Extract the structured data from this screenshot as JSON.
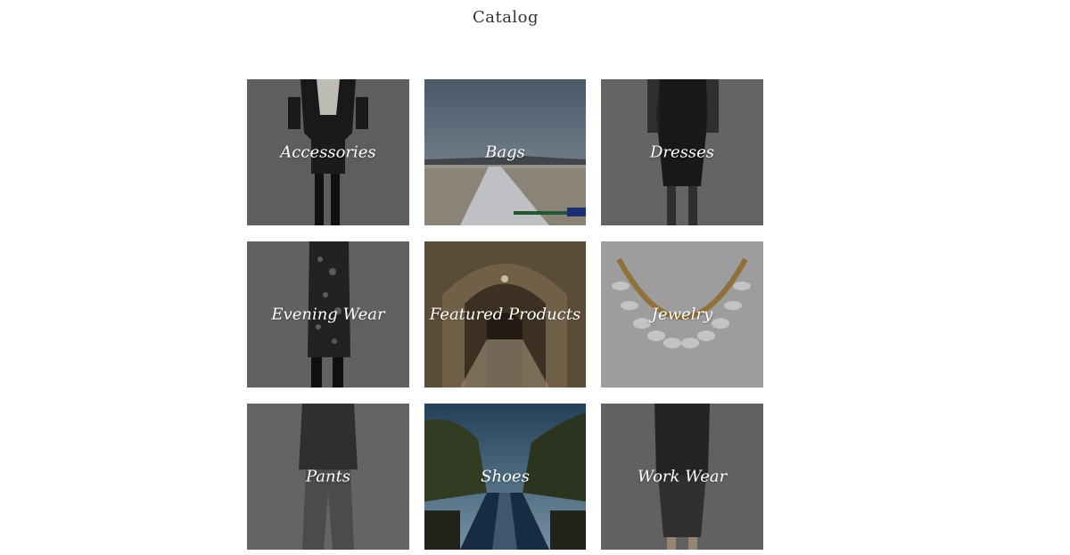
{
  "page": {
    "title": "Catalog"
  },
  "categories": [
    {
      "label": "Accessories",
      "image": "woman-black-jacket-skirt"
    },
    {
      "label": "Bags",
      "image": "snowy-road-landscape"
    },
    {
      "label": "Dresses",
      "image": "woman-black-sheer-sleeve-dress"
    },
    {
      "label": "Evening Wear",
      "image": "woman-sequin-dress"
    },
    {
      "label": "Featured Products",
      "image": "arched-hallway"
    },
    {
      "label": "Jewelry",
      "image": "white-stone-necklace"
    },
    {
      "label": "Pants",
      "image": "woman-sweater-grey-pants"
    },
    {
      "label": "Shoes",
      "image": "canal-with-trees"
    },
    {
      "label": "Work Wear",
      "image": "woman-tweed-suit"
    }
  ]
}
